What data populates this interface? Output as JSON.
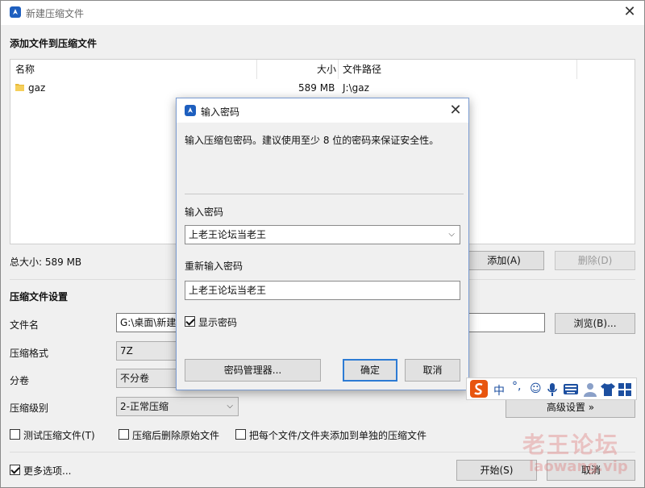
{
  "window": {
    "title": "新建压缩文件"
  },
  "add_section": {
    "heading": "添加文件到压缩文件"
  },
  "file_list": {
    "columns": {
      "name": "名称",
      "size": "大小",
      "path": "文件路径"
    },
    "rows": [
      {
        "name": "gaz",
        "size": "589 MB",
        "path": "J:\\gaz"
      }
    ]
  },
  "total_size": "总大小: 589 MB",
  "buttons": {
    "add": "添加(A)",
    "delete": "删除(D)",
    "browse": "浏览(B)...",
    "advanced": "高级设置 »",
    "start": "开始(S)",
    "cancel": "取消"
  },
  "settings": {
    "heading": "压缩文件设置",
    "filename_label": "文件名",
    "filename_value": "G:\\桌面\\新建",
    "format_label": "压缩格式",
    "format_value": "7Z",
    "split_label": "分卷",
    "split_value": "不分卷",
    "level_label": "压缩级别",
    "level_value": "2-正常压缩"
  },
  "options": {
    "test": "测试压缩文件(T)",
    "delete_after": "压缩后删除原始文件",
    "separate": "把每个文件/文件夹添加到单独的压缩文件",
    "more": "更多选项..."
  },
  "dialog": {
    "title": "输入密码",
    "description": "输入压缩包密码。建议使用至少 8 位的密码来保证安全性。",
    "password_label": "输入密码",
    "password_value": "上老王论坛当老王",
    "confirm_label": "重新输入密码",
    "confirm_value": "上老王论坛当老王",
    "show_password": "显示密码",
    "manager_button": "密码管理器...",
    "ok_button": "确定",
    "cancel_button": "取消"
  },
  "ime": {
    "mode": "中"
  },
  "watermark": {
    "line1": "老王论坛",
    "line2": "laowang.vip"
  },
  "colors": {
    "accent": "#2d7bd4",
    "icon_blue": "#1e5fbf",
    "ime_s": "#e8550f"
  }
}
